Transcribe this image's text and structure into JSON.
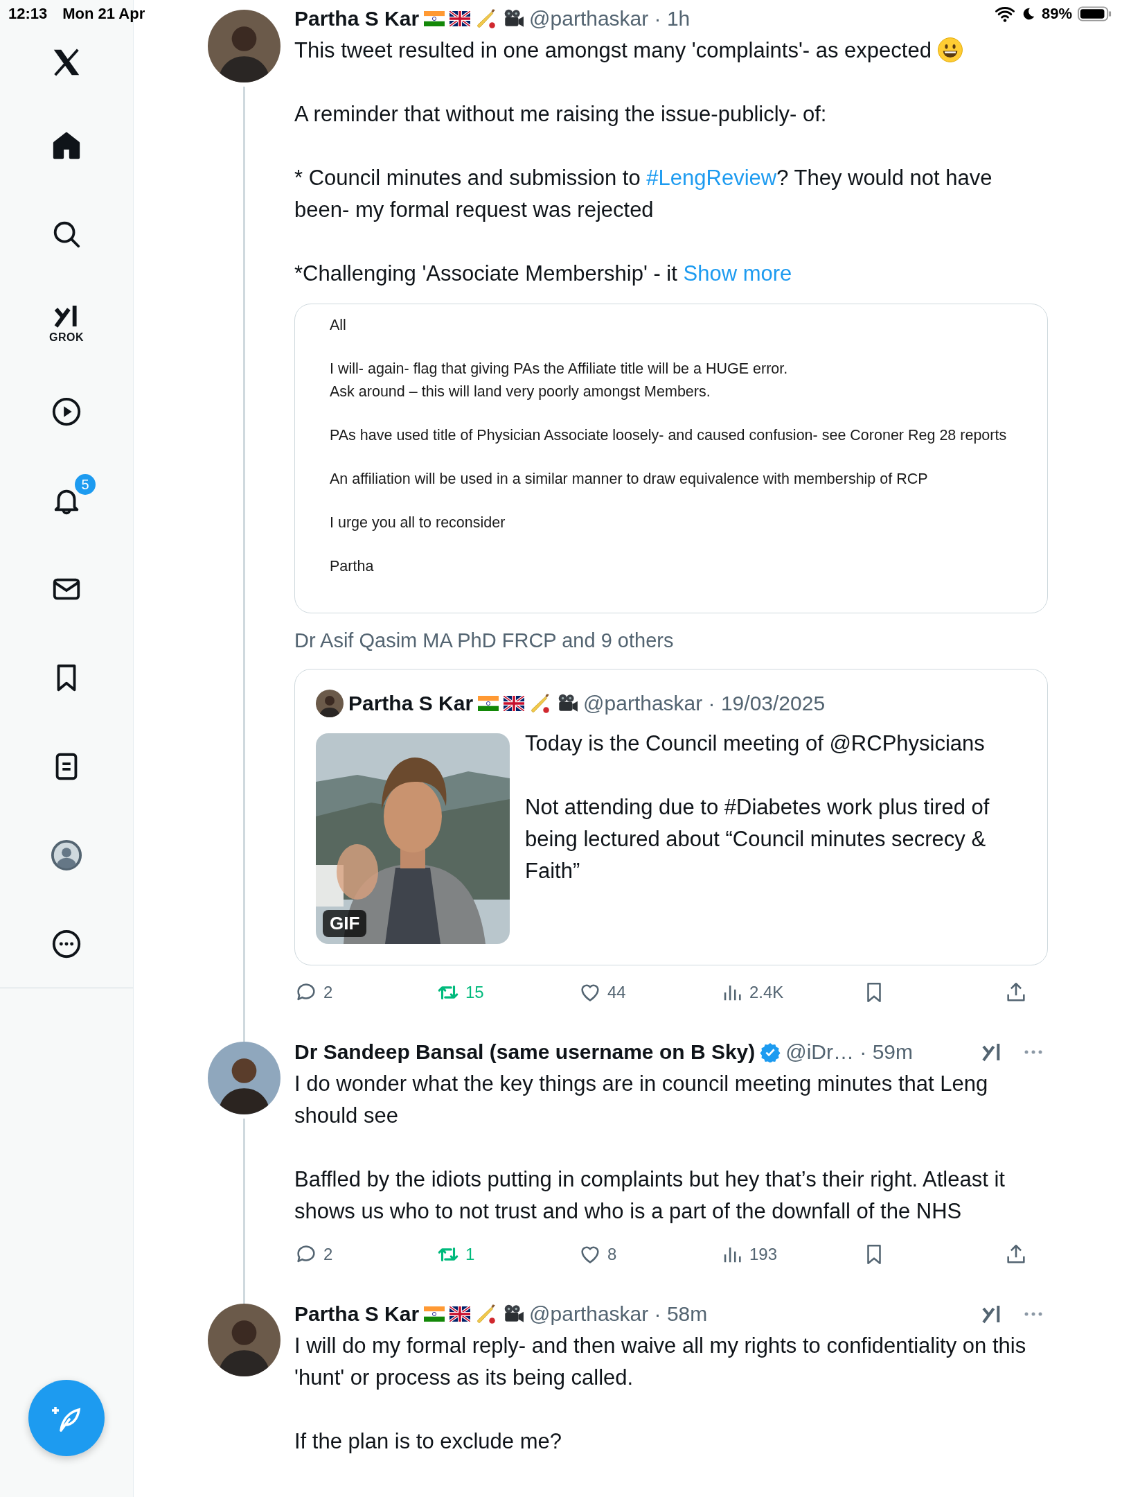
{
  "status_bar": {
    "time": "12:13",
    "date": "Mon 21 Apr",
    "battery": "89%"
  },
  "sidebar": {
    "items": [
      {
        "kind": "logo"
      },
      {
        "kind": "home"
      },
      {
        "kind": "search"
      },
      {
        "kind": "grok",
        "label": "GROK"
      },
      {
        "kind": "video"
      },
      {
        "kind": "notifications",
        "badge": "5"
      },
      {
        "kind": "messages"
      },
      {
        "kind": "bookmarks"
      },
      {
        "kind": "lists"
      },
      {
        "kind": "profile"
      },
      {
        "kind": "more"
      }
    ]
  },
  "tweets": [
    {
      "author": "Partha S Kar",
      "emojis": [
        {
          "kind": "india"
        },
        {
          "kind": "uk"
        },
        {
          "kind": "cricket"
        },
        {
          "kind": "camera"
        }
      ],
      "handle_line": "@parthaskar · 1h",
      "paragraphs": [
        [
          {
            "kind": "text",
            "text": "This tweet resulted in one amongst many 'complaints'- as expected"
          },
          {
            "kind": "emoji"
          }
        ],
        [
          {
            "kind": "text",
            "text": "A reminder that without me raising the issue-publicly- of:"
          }
        ],
        [
          {
            "kind": "text",
            "text": "* Council minutes and submission to "
          },
          {
            "kind": "link",
            "text": "#LengReview"
          },
          {
            "kind": "text",
            "text": "? They would not have been- my formal request was rejected"
          }
        ],
        [
          {
            "kind": "text",
            "text": "*Challenging 'Associate Membership' - it "
          },
          {
            "kind": "link",
            "text": "Show more"
          }
        ]
      ],
      "document": [
        [
          "All"
        ],
        [
          "I will- again- flag that giving PAs the Affiliate title will be a HUGE error.",
          "Ask around – this will land very poorly amongst Members."
        ],
        [
          "PAs have used title of Physician Associate loosely- and caused confusion- see Coroner Reg 28 reports"
        ],
        [
          "An affiliation will be used in a similar manner to draw equivalence with membership of RCP"
        ],
        [
          "I urge you all to reconsider"
        ],
        [
          "Partha"
        ]
      ],
      "tagged": "Dr Asif Qasim MA PhD FRCP and 9 others",
      "quote": {
        "author": "Partha S Kar",
        "emojis": [
          {
            "kind": "india"
          },
          {
            "kind": "uk"
          },
          {
            "kind": "cricket"
          },
          {
            "kind": "camera"
          }
        ],
        "handle_line": "@parthaskar · 19/03/2025",
        "media_label": "GIF",
        "paragraphs": [
          "Today is the Council meeting of @RCPhysicians",
          "Not attending due to #Diabetes work plus tired of being lectured about “Council minutes secrecy & Faith”"
        ]
      },
      "actions": {
        "replies": "2",
        "reposts": "15",
        "reposted": true,
        "likes": "44",
        "liked": false,
        "views": "2.4K",
        "bookmarked": false
      }
    },
    {
      "author": "Dr Sandeep Bansal (same username on B Sky)",
      "verified": true,
      "handle_line": "@iDr… · 59m",
      "menu": true,
      "paragraphs": [
        [
          {
            "kind": "text",
            "text": "I do wonder what the key things are in council meeting minutes that Leng should see"
          }
        ],
        [
          {
            "kind": "text",
            "text": "Baffled by the idiots putting in complaints but hey that’s their right. Atleast it shows us who to not trust and who is a part of the downfall of the NHS"
          }
        ]
      ],
      "actions": {
        "replies": "2",
        "reposts": "1",
        "reposted": true,
        "likes": "8",
        "liked": false,
        "views": "193",
        "bookmarked": false
      }
    },
    {
      "author": "Partha S Kar",
      "emojis": [
        {
          "kind": "india"
        },
        {
          "kind": "uk"
        },
        {
          "kind": "cricket"
        },
        {
          "kind": "camera"
        }
      ],
      "handle_line": "@parthaskar · 58m",
      "menu": true,
      "paragraphs": [
        [
          {
            "kind": "text",
            "text": "I will do my formal reply- and then waive all my rights to confidentiality on this 'hunt' or process as its being called."
          }
        ],
        [
          {
            "kind": "text",
            "text": "If the plan is to exclude me?"
          }
        ]
      ]
    }
  ]
}
